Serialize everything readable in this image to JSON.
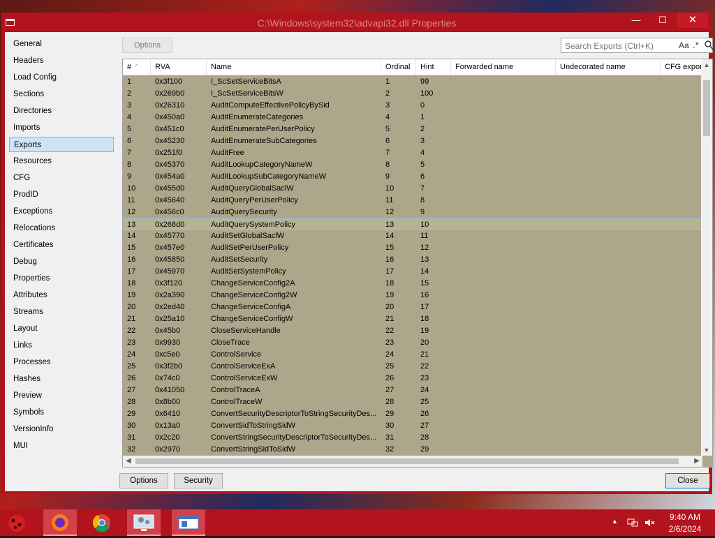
{
  "window": {
    "title": "C:\\Windows\\system32\\advapi32.dll Properties",
    "close_glyph": "✕",
    "minimize_glyph": "—",
    "maximize_glyph": "☐"
  },
  "sidebar": {
    "items": [
      {
        "label": "General"
      },
      {
        "label": "Headers"
      },
      {
        "label": "Load Config"
      },
      {
        "label": "Sections"
      },
      {
        "label": "Directories"
      },
      {
        "label": "Imports"
      },
      {
        "label": "Exports"
      },
      {
        "label": "Resources"
      },
      {
        "label": "CFG"
      },
      {
        "label": "ProdID"
      },
      {
        "label": "Exceptions"
      },
      {
        "label": "Relocations"
      },
      {
        "label": "Certificates"
      },
      {
        "label": "Debug"
      },
      {
        "label": "Properties"
      },
      {
        "label": "Attributes"
      },
      {
        "label": "Streams"
      },
      {
        "label": "Layout"
      },
      {
        "label": "Links"
      },
      {
        "label": "Processes"
      },
      {
        "label": "Hashes"
      },
      {
        "label": "Preview"
      },
      {
        "label": "Symbols"
      },
      {
        "label": "VersionInfo"
      },
      {
        "label": "MUI"
      }
    ],
    "active": "Exports"
  },
  "toolbar": {
    "options_label": "Options"
  },
  "search": {
    "placeholder": "Search Exports (Ctrl+K)",
    "case_label": "Aa",
    "regex_label": ".*"
  },
  "table": {
    "columns": [
      "#",
      "RVA",
      "Name",
      "Ordinal",
      "Hint",
      "Forwarded name",
      "Undecorated name",
      "CFG export"
    ],
    "rows": [
      [
        "1",
        "0x3f100",
        "I_ScSetServiceBitsA",
        "1",
        "99"
      ],
      [
        "2",
        "0x269b0",
        "I_ScSetServiceBitsW",
        "2",
        "100"
      ],
      [
        "3",
        "0x26310",
        "AuditComputeEffectivePolicyBySid",
        "3",
        "0"
      ],
      [
        "4",
        "0x450a0",
        "AuditEnumerateCategories",
        "4",
        "1"
      ],
      [
        "5",
        "0x451c0",
        "AuditEnumeratePerUserPolicy",
        "5",
        "2"
      ],
      [
        "6",
        "0x45230",
        "AuditEnumerateSubCategories",
        "6",
        "3"
      ],
      [
        "7",
        "0x251f0",
        "AuditFree",
        "7",
        "4"
      ],
      [
        "8",
        "0x45370",
        "AuditLookupCategoryNameW",
        "8",
        "5"
      ],
      [
        "9",
        "0x454a0",
        "AuditLookupSubCategoryNameW",
        "9",
        "6"
      ],
      [
        "10",
        "0x455d0",
        "AuditQueryGlobalSaclW",
        "10",
        "7"
      ],
      [
        "11",
        "0x45640",
        "AuditQueryPerUserPolicy",
        "11",
        "8"
      ],
      [
        "12",
        "0x456c0",
        "AuditQuerySecurity",
        "12",
        "9"
      ],
      [
        "13",
        "0x268d0",
        "AuditQuerySystemPolicy",
        "13",
        "10"
      ],
      [
        "14",
        "0x45770",
        "AuditSetGlobalSaclW",
        "14",
        "11"
      ],
      [
        "15",
        "0x457e0",
        "AuditSetPerUserPolicy",
        "15",
        "12"
      ],
      [
        "16",
        "0x45850",
        "AuditSetSecurity",
        "16",
        "13"
      ],
      [
        "17",
        "0x45970",
        "AuditSetSystemPolicy",
        "17",
        "14"
      ],
      [
        "18",
        "0x3f120",
        "ChangeServiceConfig2A",
        "18",
        "15"
      ],
      [
        "19",
        "0x2a390",
        "ChangeServiceConfig2W",
        "19",
        "16"
      ],
      [
        "20",
        "0x2ed40",
        "ChangeServiceConfigA",
        "20",
        "17"
      ],
      [
        "21",
        "0x25a10",
        "ChangeServiceConfigW",
        "21",
        "18"
      ],
      [
        "22",
        "0x45b0",
        "CloseServiceHandle",
        "22",
        "19"
      ],
      [
        "23",
        "0x9930",
        "CloseTrace",
        "23",
        "20"
      ],
      [
        "24",
        "0xc5e0",
        "ControlService",
        "24",
        "21"
      ],
      [
        "25",
        "0x3f2b0",
        "ControlServiceExA",
        "25",
        "22"
      ],
      [
        "26",
        "0x74c0",
        "ControlServiceExW",
        "26",
        "23"
      ],
      [
        "27",
        "0x41050",
        "ControlTraceA",
        "27",
        "24"
      ],
      [
        "28",
        "0x8b00",
        "ControlTraceW",
        "28",
        "25"
      ],
      [
        "29",
        "0x6410",
        "ConvertSecurityDescriptorToStringSecurityDes...",
        "29",
        "26"
      ],
      [
        "30",
        "0x13a0",
        "ConvertSidToStringSidW",
        "30",
        "27"
      ],
      [
        "31",
        "0x2c20",
        "ConvertStringSecurityDescriptorToSecurityDes...",
        "31",
        "28"
      ],
      [
        "32",
        "0x2970",
        "ConvertStringSidToSidW",
        "32",
        "29"
      ]
    ],
    "selected_row": "13"
  },
  "bottom": {
    "options_label": "Options",
    "security_label": "Security",
    "close_label": "Close"
  },
  "taskbar": {
    "time": "9:40 AM",
    "date": "2/6/2024",
    "apps": [
      "ladybug-start-icon",
      "firefox-icon",
      "chrome-icon",
      "system-monitor-icon",
      "properties-window-icon"
    ]
  },
  "colors": {
    "window_frame": "#b3131d",
    "grid_bg": "#ada68a",
    "selection_border": "#7ab7e0"
  }
}
